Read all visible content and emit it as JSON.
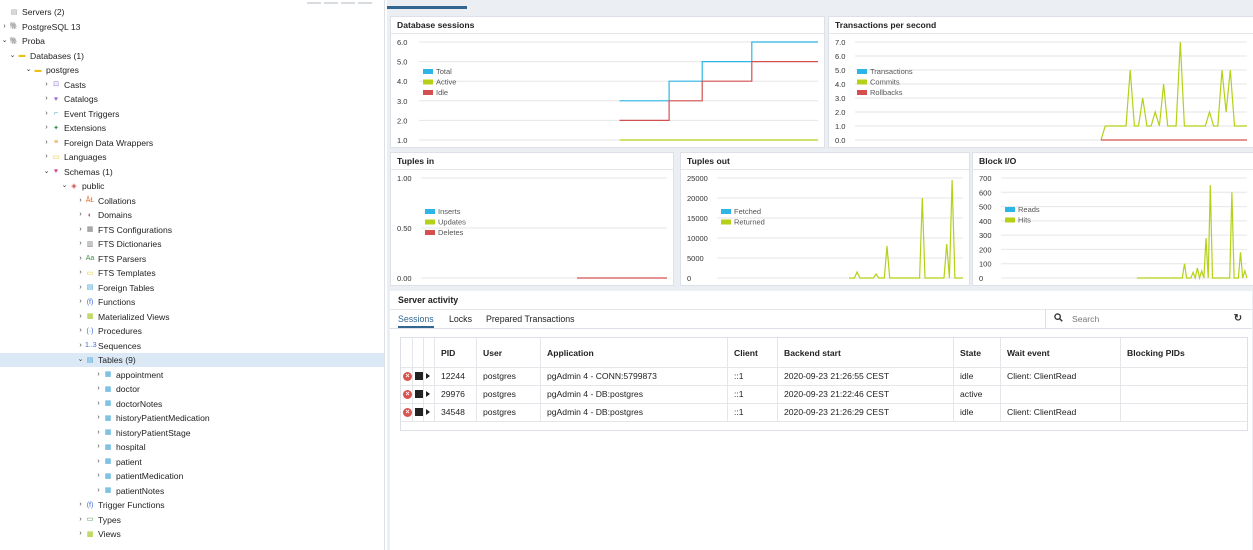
{
  "tree": {
    "items": [
      {
        "label": "Servers (2)",
        "arrow": "",
        "icon": "servers-icon",
        "color": "#999999",
        "sym": "▤"
      },
      {
        "label": "PostgreSQL 13",
        "arrow": "›",
        "icon": "elephant-icon",
        "color": "#336791",
        "sym": "🐘"
      },
      {
        "label": "Proba",
        "arrow": "⌄",
        "icon": "elephant-icon",
        "color": "#336791",
        "sym": "🐘"
      },
      {
        "label": "Databases (1)",
        "arrow": "⌄",
        "icon": "database-icon",
        "color": "#e8c21a",
        "sym": "▬"
      },
      {
        "label": "postgres",
        "arrow": "⌄",
        "icon": "database-icon",
        "color": "#e8c21a",
        "sym": "▬"
      },
      {
        "label": "Casts",
        "arrow": "›",
        "icon": "casts-icon",
        "color": "#8a6bd1",
        "sym": "⊡"
      },
      {
        "label": "Catalogs",
        "arrow": "›",
        "icon": "catalogs-icon",
        "color": "#a56bd1",
        "sym": "♥"
      },
      {
        "label": "Event Triggers",
        "arrow": "›",
        "icon": "event-trigger-icon",
        "color": "#3aa0b5",
        "sym": "⌐"
      },
      {
        "label": "Extensions",
        "arrow": "›",
        "icon": "extensions-icon",
        "color": "#3a8f4a",
        "sym": "✦"
      },
      {
        "label": "Foreign Data Wrappers",
        "arrow": "›",
        "icon": "fdw-icon",
        "color": "#e88a1a",
        "sym": "≡"
      },
      {
        "label": "Languages",
        "arrow": "›",
        "icon": "languages-icon",
        "color": "#e8c21a",
        "sym": "▭"
      },
      {
        "label": "Schemas (1)",
        "arrow": "⌄",
        "icon": "schemas-icon",
        "color": "#d14a8a",
        "sym": "♥"
      },
      {
        "label": "public",
        "arrow": "⌄",
        "icon": "schema-icon",
        "color": "#d14a4a",
        "sym": "◈"
      },
      {
        "label": "Collations",
        "arrow": "›",
        "icon": "collations-icon",
        "color": "#e86a1a",
        "sym": "ÅŁ"
      },
      {
        "label": "Domains",
        "arrow": "›",
        "icon": "domains-icon",
        "color": "#d14a4a",
        "sym": "◐"
      },
      {
        "label": "FTS Configurations",
        "arrow": "›",
        "icon": "fts-config-icon",
        "color": "#777777",
        "sym": "▦"
      },
      {
        "label": "FTS Dictionaries",
        "arrow": "›",
        "icon": "fts-dict-icon",
        "color": "#777777",
        "sym": "▥"
      },
      {
        "label": "FTS Parsers",
        "arrow": "›",
        "icon": "fts-parser-icon",
        "color": "#3a8f4a",
        "sym": "Aa"
      },
      {
        "label": "FTS Templates",
        "arrow": "›",
        "icon": "fts-template-icon",
        "color": "#e8c21a",
        "sym": "▭"
      },
      {
        "label": "Foreign Tables",
        "arrow": "›",
        "icon": "foreign-table-icon",
        "color": "#3aa0d1",
        "sym": "▤"
      },
      {
        "label": "Functions",
        "arrow": "›",
        "icon": "function-icon",
        "color": "#3a6bd1",
        "sym": "(f)"
      },
      {
        "label": "Materialized Views",
        "arrow": "›",
        "icon": "mview-icon",
        "color": "#a0c81a",
        "sym": "▩"
      },
      {
        "label": "Procedures",
        "arrow": "›",
        "icon": "procedure-icon",
        "color": "#3a6bd1",
        "sym": "(·)"
      },
      {
        "label": "Sequences",
        "arrow": "›",
        "icon": "sequence-icon",
        "color": "#3a6bd1",
        "sym": "1..3"
      },
      {
        "label": "Tables (9)",
        "arrow": "⌄",
        "icon": "tables-icon",
        "color": "#3aa0d1",
        "sym": "▤",
        "selected": true
      },
      {
        "label": "appointment",
        "arrow": "›",
        "icon": "table-icon",
        "color": "#3aa0d1",
        "sym": "▦"
      },
      {
        "label": "doctor",
        "arrow": "›",
        "icon": "table-icon",
        "color": "#3aa0d1",
        "sym": "▦"
      },
      {
        "label": "doctorNotes",
        "arrow": "›",
        "icon": "table-icon",
        "color": "#3aa0d1",
        "sym": "▦"
      },
      {
        "label": "historyPatientMedication",
        "arrow": "›",
        "icon": "table-icon",
        "color": "#3aa0d1",
        "sym": "▦"
      },
      {
        "label": "historyPatientStage",
        "arrow": "›",
        "icon": "table-icon",
        "color": "#3aa0d1",
        "sym": "▦"
      },
      {
        "label": "hospital",
        "arrow": "›",
        "icon": "table-icon",
        "color": "#3aa0d1",
        "sym": "▦"
      },
      {
        "label": "patient",
        "arrow": "›",
        "icon": "table-icon",
        "color": "#3aa0d1",
        "sym": "▦"
      },
      {
        "label": "patientMedication",
        "arrow": "›",
        "icon": "table-icon",
        "color": "#3aa0d1",
        "sym": "▦"
      },
      {
        "label": "patientNotes",
        "arrow": "›",
        "icon": "table-icon",
        "color": "#3aa0d1",
        "sym": "▦"
      },
      {
        "label": "Trigger Functions",
        "arrow": "›",
        "icon": "trigger-function-icon",
        "color": "#3a6bd1",
        "sym": "(f)"
      },
      {
        "label": "Types",
        "arrow": "›",
        "icon": "types-icon",
        "color": "#3a8f4a",
        "sym": "▭"
      },
      {
        "label": "Views",
        "arrow": "›",
        "icon": "views-icon",
        "color": "#a0c81a",
        "sym": "▩"
      }
    ]
  },
  "charts": {
    "sessions": {
      "title": "Database sessions"
    },
    "tps": {
      "title": "Transactions per second"
    },
    "tuples_in": {
      "title": "Tuples in"
    },
    "tuples_out": {
      "title": "Tuples out"
    },
    "block_io": {
      "title": "Block I/O"
    }
  },
  "chart_data": [
    {
      "type": "line",
      "title": "Database sessions",
      "ylim": [
        1,
        6
      ],
      "yticks": [
        "6.0",
        "5.0",
        "4.0",
        "3.0",
        "2.0",
        "1.0"
      ],
      "x": [
        0,
        1,
        2,
        3,
        4,
        5,
        6,
        7,
        8,
        9,
        10,
        11,
        12,
        13,
        14,
        15,
        16,
        17,
        18,
        19,
        20,
        21,
        22,
        23,
        24
      ],
      "series": [
        {
          "name": "Total",
          "color": "#2cb5e6",
          "values": [
            null,
            null,
            null,
            null,
            null,
            null,
            null,
            null,
            null,
            null,
            null,
            null,
            3,
            3,
            3,
            4,
            4,
            5,
            5,
            5,
            6,
            6,
            6,
            6,
            6
          ]
        },
        {
          "name": "Active",
          "color": "#b5d016",
          "values": [
            null,
            null,
            null,
            null,
            null,
            null,
            null,
            null,
            null,
            null,
            null,
            null,
            1,
            1,
            1,
            1,
            1,
            1,
            1,
            1,
            1,
            1,
            1,
            1,
            1
          ]
        },
        {
          "name": "Idle",
          "color": "#d45050",
          "values": [
            null,
            null,
            null,
            null,
            null,
            null,
            null,
            null,
            null,
            null,
            null,
            null,
            2,
            2,
            2,
            3,
            3,
            4,
            4,
            4,
            5,
            5,
            5,
            5,
            5
          ]
        }
      ]
    },
    {
      "type": "line",
      "title": "Transactions per second",
      "ylim": [
        0,
        7
      ],
      "yticks": [
        "7.0",
        "6.0",
        "5.0",
        "4.0",
        "3.0",
        "2.0",
        "1.0",
        "0.0"
      ],
      "series": [
        {
          "name": "Transactions",
          "color": "#2cb5e6",
          "values": []
        },
        {
          "name": "Commits",
          "color": "#b5d016",
          "values": [
            0,
            1,
            1,
            1,
            1,
            1,
            1,
            5,
            1,
            1,
            3,
            1,
            1,
            2,
            1,
            4,
            1,
            1,
            1,
            7,
            1,
            1,
            1,
            1,
            1,
            1,
            2,
            1,
            1,
            5,
            2,
            5,
            1,
            1,
            1,
            1
          ]
        },
        {
          "name": "Rollbacks",
          "color": "#d45050",
          "values": [
            0,
            0,
            0,
            0,
            0,
            0,
            0,
            0,
            0,
            0,
            0,
            0,
            0,
            0,
            0,
            0,
            0,
            0,
            0,
            0,
            0,
            0,
            0,
            0,
            0,
            0,
            0,
            0,
            0,
            0,
            0,
            0,
            0,
            0,
            0,
            0
          ]
        }
      ]
    },
    {
      "type": "line",
      "title": "Tuples in",
      "ylim": [
        0,
        1
      ],
      "yticks": [
        "1.00",
        "0.50",
        "0.00"
      ],
      "series": [
        {
          "name": "Inserts",
          "color": "#2cb5e6",
          "values": []
        },
        {
          "name": "Updates",
          "color": "#b5d016",
          "values": []
        },
        {
          "name": "Deletes",
          "color": "#d45050",
          "values": [
            0,
            0,
            0,
            0,
            0,
            0,
            0,
            0,
            0,
            0,
            0,
            0,
            0
          ]
        }
      ]
    },
    {
      "type": "line",
      "title": "Tuples out",
      "ylim": [
        0,
        25000
      ],
      "yticks": [
        "25000",
        "20000",
        "15000",
        "10000",
        "5000",
        "0"
      ],
      "series": [
        {
          "name": "Fetched",
          "color": "#2cb5e6",
          "values": []
        },
        {
          "name": "Returned",
          "color": "#b5d016",
          "values": [
            0,
            0,
            0,
            1500,
            0,
            0,
            0,
            0,
            0,
            0,
            1000,
            0,
            0,
            0,
            8000,
            0,
            0,
            0,
            0,
            0,
            0,
            0,
            0,
            0,
            0,
            0,
            0,
            20000,
            0,
            0,
            0,
            0,
            0,
            0,
            0,
            0,
            8500,
            0,
            24500,
            0,
            0,
            0,
            0
          ]
        }
      ]
    },
    {
      "type": "line",
      "title": "Block I/O",
      "ylim": [
        0,
        700
      ],
      "yticks": [
        "700",
        "600",
        "500",
        "400",
        "300",
        "200",
        "100",
        "0"
      ],
      "series": [
        {
          "name": "Reads",
          "color": "#2cb5e6",
          "values": []
        },
        {
          "name": "Hits",
          "color": "#b5d016",
          "values": [
            0,
            0,
            0,
            0,
            0,
            0,
            0,
            0,
            0,
            0,
            0,
            0,
            0,
            0,
            0,
            0,
            0,
            0,
            0,
            0,
            0,
            0,
            100,
            0,
            0,
            0,
            40,
            0,
            70,
            0,
            50,
            0,
            280,
            0,
            650,
            0,
            0,
            0,
            0,
            0,
            0,
            0,
            0,
            0,
            600,
            0,
            0,
            0,
            180,
            0,
            50,
            0
          ]
        }
      ]
    }
  ],
  "activity": {
    "title": "Server activity",
    "tabs": [
      "Sessions",
      "Locks",
      "Prepared Transactions"
    ],
    "search_placeholder": "Search",
    "columns": [
      "",
      "",
      "",
      "PID",
      "User",
      "Application",
      "Client",
      "Backend start",
      "State",
      "Wait event",
      "Blocking PIDs"
    ],
    "rows": [
      {
        "pid": "12244",
        "user": "postgres",
        "app": "pgAdmin 4 - CONN:5799873",
        "client": "::1",
        "start": "2020-09-23 21:26:55 CEST",
        "state": "idle",
        "wait": "Client: ClientRead",
        "blocking": ""
      },
      {
        "pid": "29976",
        "user": "postgres",
        "app": "pgAdmin 4 - DB:postgres",
        "client": "::1",
        "start": "2020-09-23 21:22:46 CEST",
        "state": "active",
        "wait": "",
        "blocking": ""
      },
      {
        "pid": "34548",
        "user": "postgres",
        "app": "pgAdmin 4 - DB:postgres",
        "client": "::1",
        "start": "2020-09-23 21:26:29 CEST",
        "state": "idle",
        "wait": "Client: ClientRead",
        "blocking": ""
      }
    ]
  }
}
